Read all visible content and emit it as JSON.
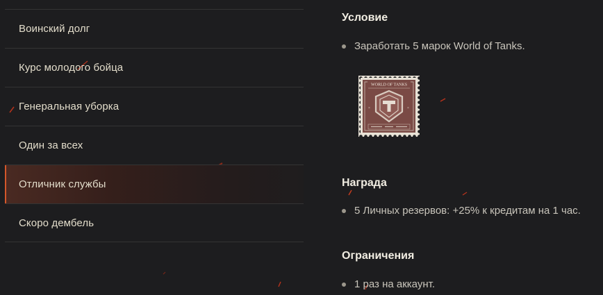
{
  "sidebar": {
    "items": [
      {
        "label": "Воинский долг",
        "active": false
      },
      {
        "label": "Курс молодого бойца",
        "active": false
      },
      {
        "label": "Генеральная уборка",
        "active": false
      },
      {
        "label": "Один за всех",
        "active": false
      },
      {
        "label": "Отличник службы",
        "active": true
      },
      {
        "label": "Скоро дембель",
        "active": false
      }
    ]
  },
  "condition": {
    "title": "Условие",
    "bullet": "Заработать 5 марок World of Tanks.",
    "stamp_text": "WORLD OF TANKS"
  },
  "reward": {
    "title": "Награда",
    "bullet": "5 Личных резервов: +25% к кредитам на 1 час."
  },
  "restrictions": {
    "title": "Ограничения",
    "bullet": "1 раз на аккаунт."
  },
  "colors": {
    "background": "#1d1d1f",
    "accent": "#d4572a",
    "stamp": "#7a4a45"
  }
}
